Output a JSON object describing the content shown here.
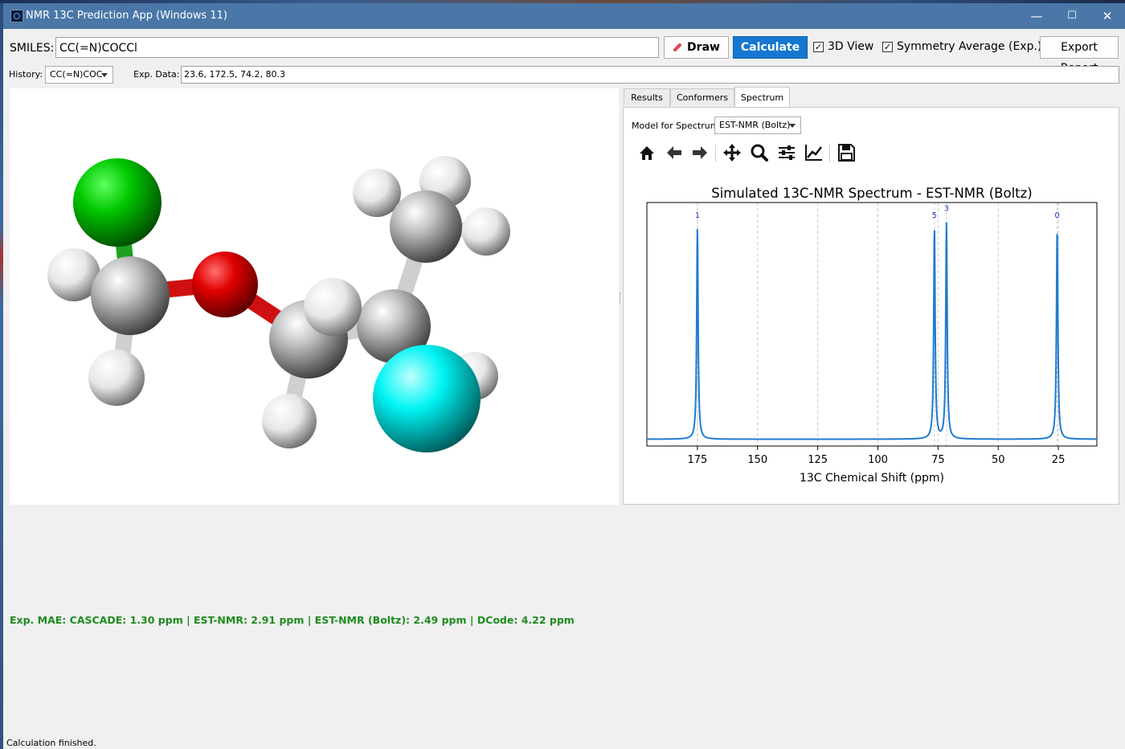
{
  "window": {
    "title": "NMR 13C Prediction App (Windows 11)",
    "minimize": "—",
    "maximize": "☐",
    "close": "✕"
  },
  "toolbar": {
    "smiles_label": "SMILES:",
    "smiles_value": "CC(=N)COCCl",
    "draw_label": "Draw",
    "calculate_label": "Calculate",
    "view3d_label": "3D View",
    "view3d_checked": true,
    "symmetry_label": "Symmetry Average (Exp.)",
    "symmetry_checked": true,
    "export_label": "Export Report"
  },
  "history": {
    "label": "History:",
    "selected": "CC(=N)COC",
    "exp_label": "Exp. Data:",
    "exp_value": "23.6, 172.5, 74.2, 80.3"
  },
  "tabs": [
    {
      "label": "Results",
      "active": false
    },
    {
      "label": "Conformers",
      "active": false
    },
    {
      "label": "Spectrum",
      "active": true
    }
  ],
  "spectrum": {
    "model_label": "Model for Spectrum:",
    "model_selected": "EST-NMR (Boltz)",
    "toolbar_icons": [
      "home-icon",
      "back-icon",
      "forward-icon",
      "pan-icon",
      "zoom-icon",
      "configure-icon",
      "edit-axis-icon",
      "save-icon"
    ]
  },
  "chart_data": {
    "type": "line",
    "title": "Simulated 13C-NMR Spectrum - EST-NMR (Boltz)",
    "xlabel": "13C Chemical Shift (ppm)",
    "ylabel": "",
    "xlim": [
      196,
      9
    ],
    "ylim": [
      0,
      1.07
    ],
    "x_inverted": true,
    "xticks": [
      175,
      150,
      125,
      100,
      75,
      50,
      25
    ],
    "grid": "vertical dashed",
    "line_color": "#1f7bd1",
    "peaks": [
      {
        "label": "1",
        "shift": 175.0,
        "height": 0.96
      },
      {
        "label": "5",
        "shift": 76.5,
        "height": 0.96
      },
      {
        "label": "3",
        "shift": 71.5,
        "height": 0.98
      },
      {
        "label": "0",
        "shift": 25.5,
        "height": 0.96
      }
    ],
    "baseline": 0.03
  },
  "molecule": {
    "atoms": [
      {
        "element": "Cl",
        "color": "#00cc00"
      },
      {
        "element": "C",
        "color": "#a8a8a8"
      },
      {
        "element": "O",
        "color": "#ff0000"
      },
      {
        "element": "C",
        "color": "#a8a8a8"
      },
      {
        "element": "C",
        "color": "#a8a8a8"
      },
      {
        "element": "C",
        "color": "#a8a8a8"
      },
      {
        "element": "N",
        "color": "#00ffff"
      },
      {
        "element": "H",
        "color": "#ffffff"
      }
    ]
  },
  "mae_text": "Exp. MAE: CASCADE: 1.30 ppm | EST-NMR: 2.91 ppm | EST-NMR (Boltz): 2.49 ppm | DCode: 4.22 ppm",
  "status": "Calculation finished."
}
